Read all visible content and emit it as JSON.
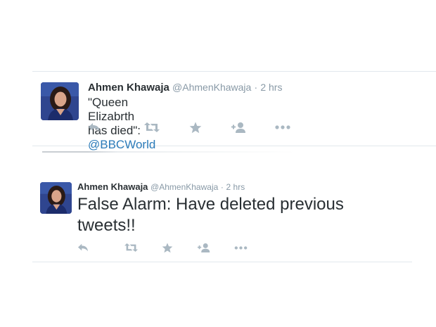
{
  "tweets": [
    {
      "name": "Ahmen Khawaja",
      "handle": "@AhmenKhawaja",
      "separator": "·",
      "time": "2 hrs",
      "text": "\"Queen Elizabrth has died\": ",
      "mention": "@BBCWorld"
    },
    {
      "name": "Ahmen Khawaja",
      "handle": "@AhmenKhawaja",
      "separator": "·",
      "time": "2 hrs",
      "text": "False Alarm: Have deleted previous tweets!!",
      "mention": ""
    }
  ],
  "actions": [
    "reply-icon",
    "retweet-icon",
    "favorite-icon",
    "follow-icon",
    "more-icon"
  ],
  "colors": {
    "name": "#292f33",
    "meta": "#8899a6",
    "link": "#2b7bb9",
    "icon": "#aab8c2",
    "divider": "#e1e8ed"
  }
}
